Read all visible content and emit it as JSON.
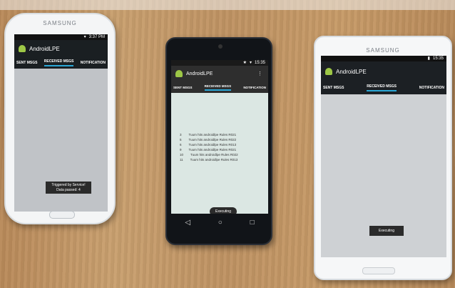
{
  "phones": [
    {
      "brand": "SAMSUNG",
      "status_time": "3:37 PM",
      "app_title": "AndroidLPE",
      "tabs": [
        "SENT MSGS",
        "RECEIVED MSGS",
        "NOTIFICATION"
      ],
      "active_tab": "RECEIVED MSGS",
      "toast_line1": "Triggered by Service!",
      "toast_line2": "Data passed: 4"
    },
    {
      "status_time": "15:35",
      "app_title": "AndroidLPE",
      "tabs": [
        "SENT MSGS",
        "RECEIVED MSGS",
        "NOTIFICATION"
      ],
      "active_tab": "RECEIVED MSGS",
      "messages": [
        {
          "id": "3",
          "text": "Tuum hits androidlpe Rules R021"
        },
        {
          "id": "5",
          "text": "Tuum hits androidlpe Rules R022"
        },
        {
          "id": "6",
          "text": "Tuum hits androidlpe Rules R013"
        },
        {
          "id": "9",
          "text": "Tuum hits androidlpe Rules R021"
        },
        {
          "id": "10",
          "text": "Tuum hits androidlpe Rules R022"
        },
        {
          "id": "11",
          "text": "Tuum hits androidlpe Rules R013"
        }
      ],
      "toast": "Executing"
    },
    {
      "brand": "SAMSUNG",
      "status_time": "15:35",
      "app_title": "AndroidLPE",
      "tabs": [
        "SENT MSGS",
        "RECEIVED MSGS",
        "NOTIFICATION"
      ],
      "active_tab": "RECEIVED MSGS",
      "toast": "Executing"
    }
  ]
}
